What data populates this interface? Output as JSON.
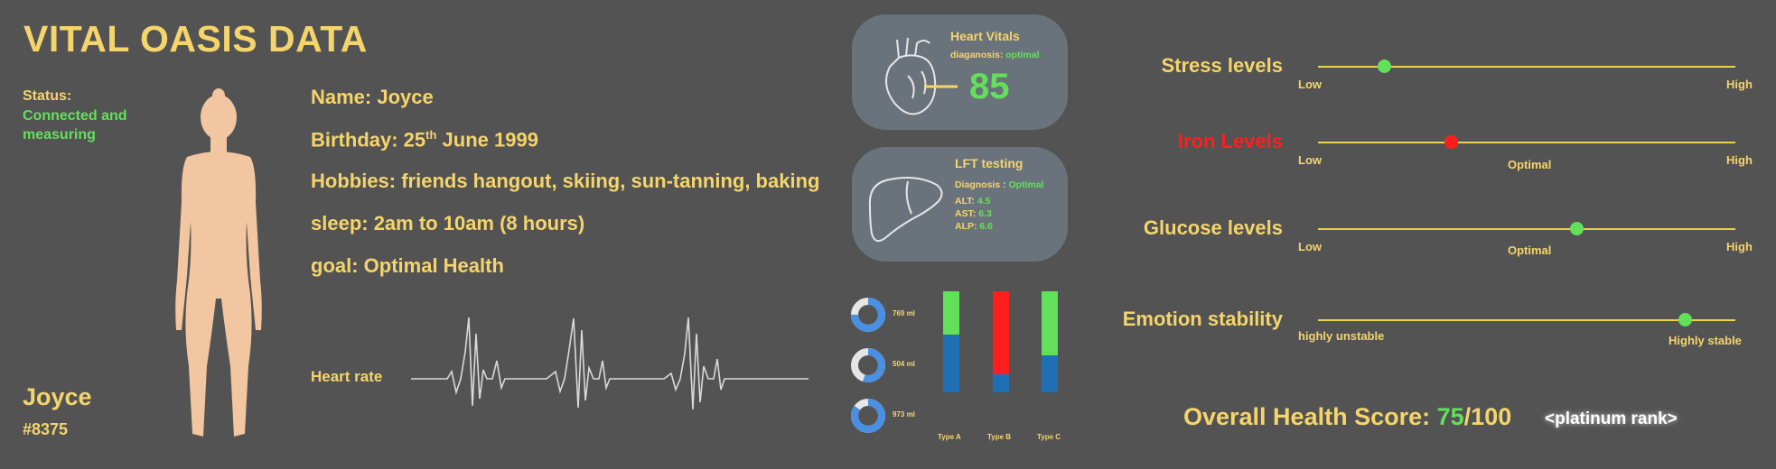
{
  "header": {
    "title": "VITAL OASIS DATA"
  },
  "status": {
    "label": "Status:",
    "value": "Connected and measuring"
  },
  "user": {
    "name": "Joyce",
    "id": "#8375"
  },
  "profile": {
    "name": "Name: Joyce",
    "birthday_prefix": "Birthday: 25",
    "birthday_sup": "th",
    "birthday_suffix": " June 1999",
    "hobbies": "Hobbies: friends hangout, skiing, sun-tanning, baking",
    "sleep": "sleep: 2am to 10am (8 hours)",
    "goal": "goal: Optimal Health"
  },
  "heart_rate": {
    "label": "Heart rate"
  },
  "heart_card": {
    "title": "Heart Vitals",
    "diag_label": "diaganosis: ",
    "diag_value": "optimal",
    "value": "85"
  },
  "lft_card": {
    "title": "LFT testing",
    "diag_label": "Diagnosis : ",
    "diag_value": "Optimal",
    "rows": [
      {
        "label": "ALT: ",
        "value": "4.5"
      },
      {
        "label": "AST: ",
        "value": "6.3"
      },
      {
        "label": "ALP: ",
        "value": "6.6"
      }
    ]
  },
  "donuts": [
    {
      "label": "769 ml",
      "fraction": 0.75
    },
    {
      "label": "504 ml",
      "fraction": 0.55
    },
    {
      "label": "973 ml",
      "fraction": 0.85
    }
  ],
  "bars": [
    {
      "label": "Type A",
      "top_color": "#63e05a",
      "bottom_color": "#1f6fb5",
      "top_fraction": 0.43
    },
    {
      "label": "Type B",
      "top_color": "#ff1e1e",
      "bottom_color": "#1f6fb5",
      "top_fraction": 0.82
    },
    {
      "label": "Type C",
      "top_color": "#63e05a",
      "bottom_color": "#1f6fb5",
      "top_fraction": 0.63
    }
  ],
  "sliders": {
    "stress": {
      "label": "Stress levels",
      "low": "Low",
      "high": "High",
      "mid": "",
      "level": 0.16,
      "knob_color": "#63e05a"
    },
    "iron": {
      "label": "Iron Levels",
      "low": "Low",
      "high": "High",
      "mid": "Optimal",
      "level": 0.32,
      "knob_color": "#ff1e1e"
    },
    "glucose": {
      "label": "Glucose levels",
      "low": "Low",
      "high": "High",
      "mid": "Optimal",
      "level": 0.62,
      "knob_color": "#63e05a"
    },
    "emotion": {
      "label": "Emotion stability",
      "low": "highly unstable",
      "high": "Highly stable",
      "mid": "",
      "level": 0.88,
      "knob_color": "#63e05a"
    }
  },
  "score": {
    "label": "Overall Health Score: ",
    "value": "75",
    "total": "/100",
    "rank": "<platinum rank>"
  },
  "colors": {
    "background": "#535353",
    "accent_yellow": "#f5d56b",
    "good_green": "#63e05a",
    "alert_red": "#ff1e1e",
    "card_gray": "#6a737b"
  }
}
